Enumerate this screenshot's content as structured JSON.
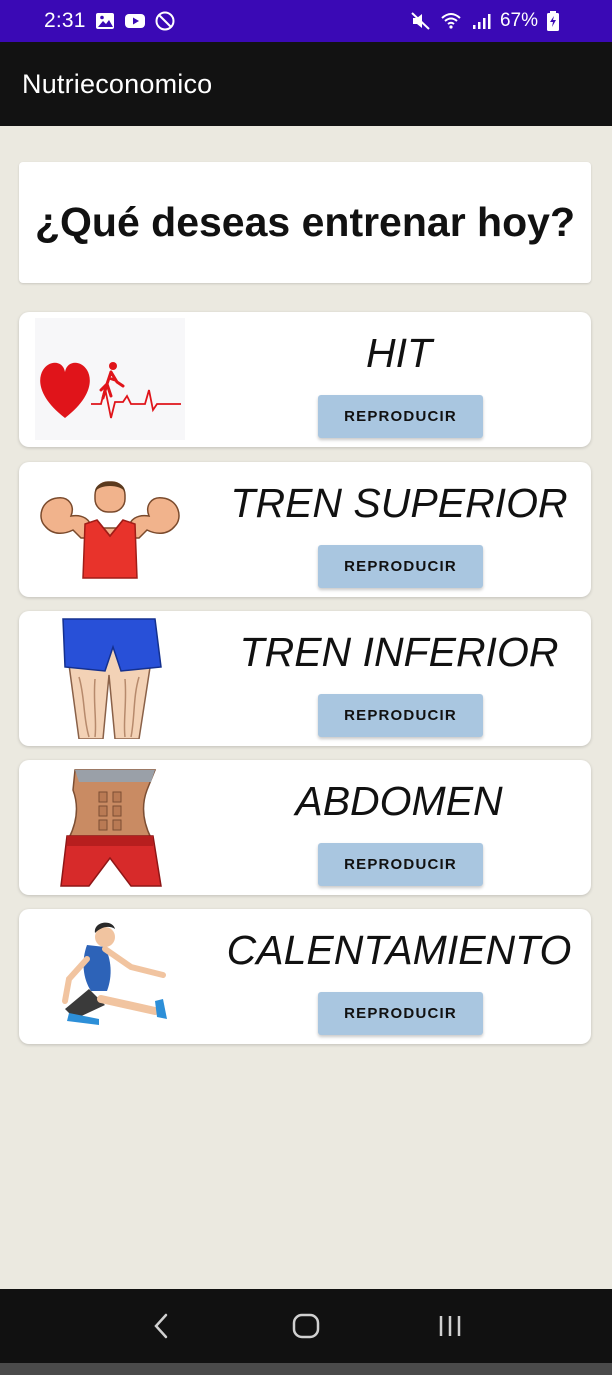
{
  "status_bar": {
    "time": "2:31",
    "battery": "67%",
    "left_icons": [
      "gallery-icon",
      "youtube-icon",
      "do-not-disturb-icon"
    ],
    "right_icons": [
      "mute-icon",
      "wifi-icon",
      "signal-icon",
      "battery-icon"
    ],
    "background": "#3a09b5"
  },
  "app_bar": {
    "title": "Nutrieconomico",
    "background": "#121212"
  },
  "header": {
    "title": "¿Qué deseas entrenar hoy?"
  },
  "workouts": [
    {
      "title": "HIT",
      "button_label": "REPRODUCIR",
      "icon": "heartbeat-runner-image"
    },
    {
      "title": "TREN SUPERIOR",
      "button_label": "REPRODUCIR",
      "icon": "flexing-man-image"
    },
    {
      "title": "TREN INFERIOR",
      "button_label": "REPRODUCIR",
      "icon": "legs-muscles-image"
    },
    {
      "title": "ABDOMEN",
      "button_label": "REPRODUCIR",
      "icon": "abs-torso-image"
    },
    {
      "title": "CALENTAMIENTO",
      "button_label": "REPRODUCIR",
      "icon": "stretching-woman-image"
    }
  ],
  "colors": {
    "page_background": "#ebe9e0",
    "button": "#a9c6e0",
    "nav_background": "#111111"
  },
  "nav_bar": {
    "buttons": [
      "back-icon",
      "home-icon",
      "recents-icon"
    ]
  }
}
